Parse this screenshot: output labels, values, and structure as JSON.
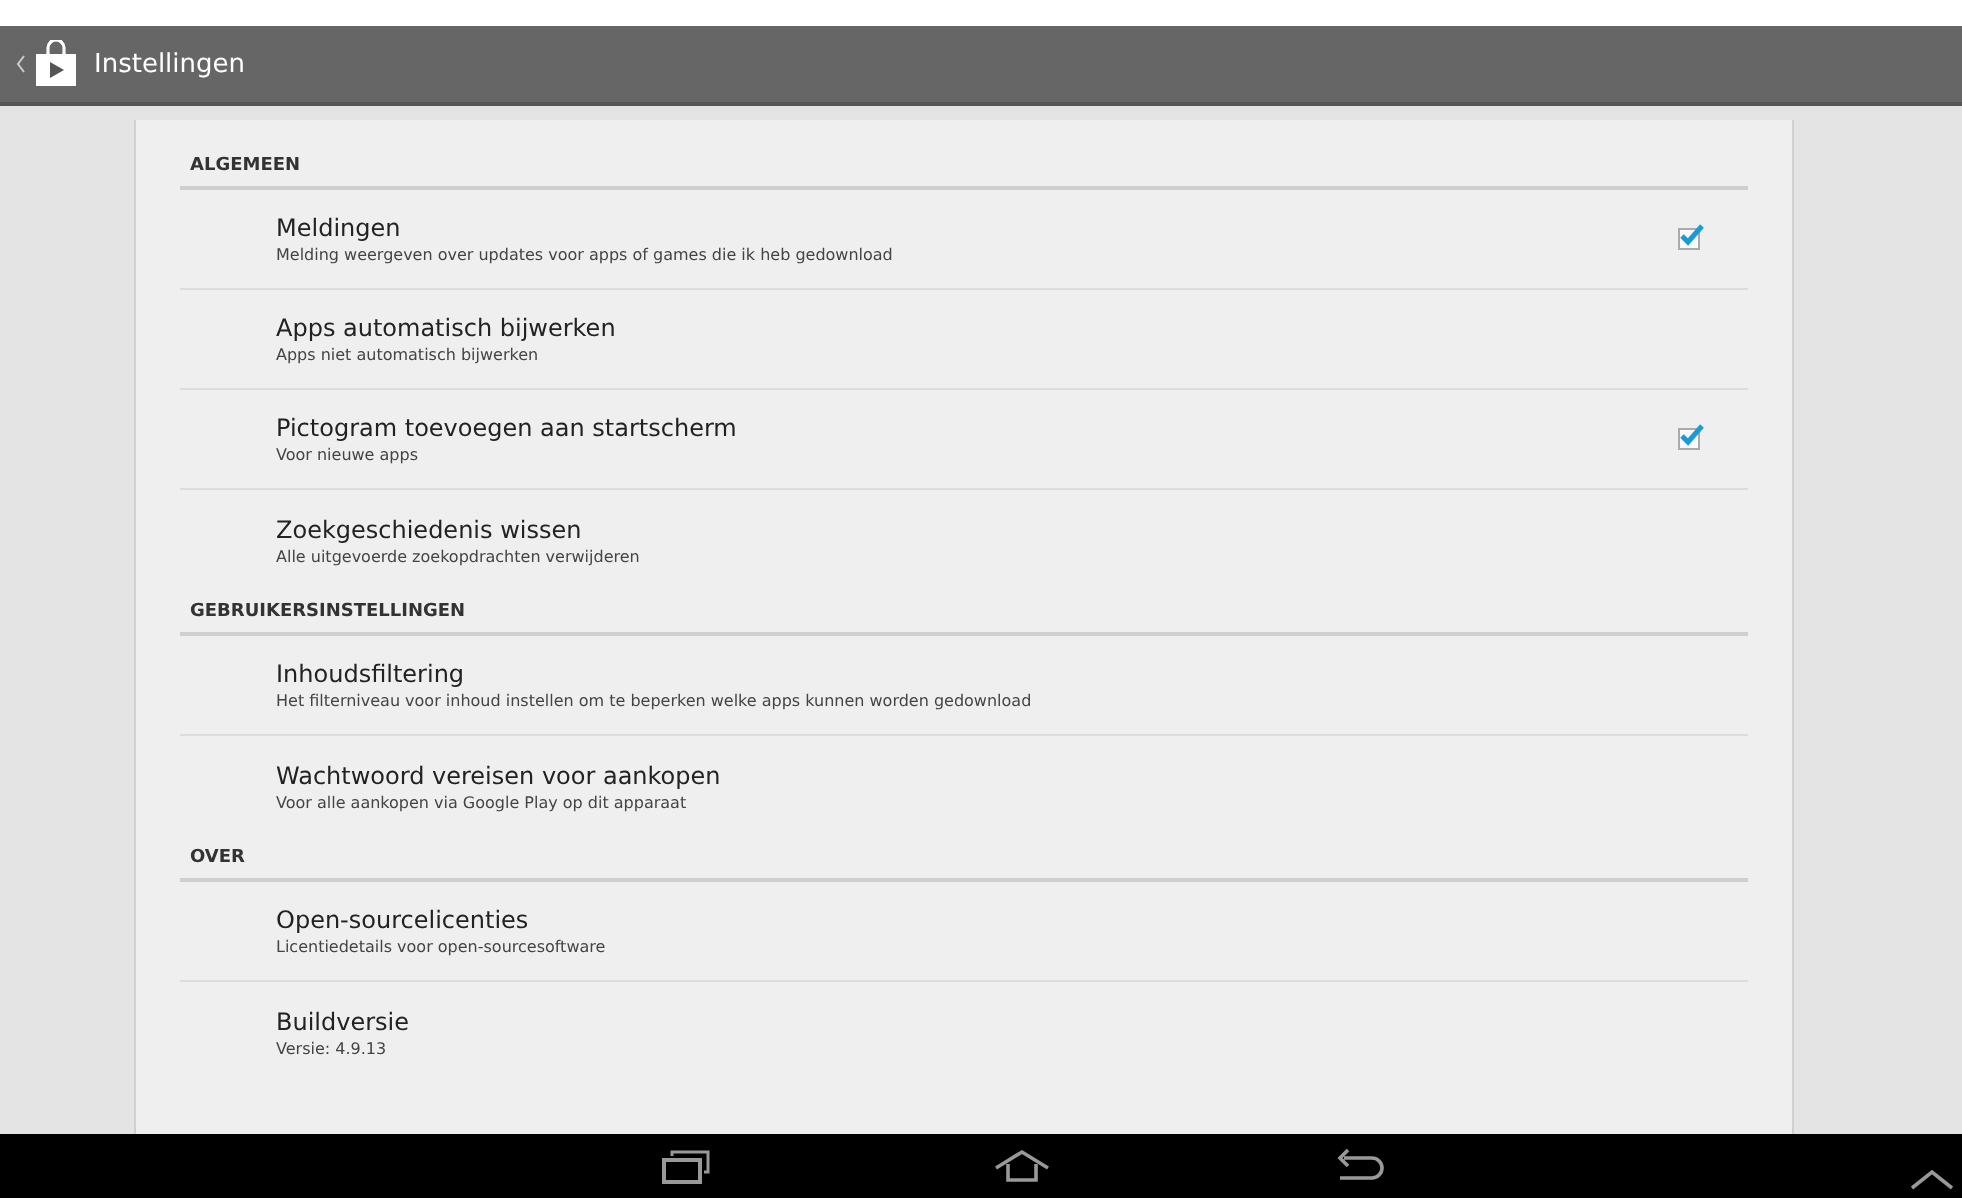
{
  "action_bar": {
    "title": "Instellingen"
  },
  "sections": [
    {
      "heading": "ALGEMEEN",
      "items": [
        {
          "title": "Meldingen",
          "summary": "Melding weergeven over updates voor apps of games die ik heb gedownload",
          "kind": "checkbox",
          "checked": true
        },
        {
          "title": "Apps automatisch bijwerken",
          "summary": "Apps niet automatisch bijwerken",
          "kind": "plain"
        },
        {
          "title": "Pictogram toevoegen aan startscherm",
          "summary": "Voor nieuwe apps",
          "kind": "checkbox",
          "checked": true
        },
        {
          "title": "Zoekgeschiedenis wissen",
          "summary": "Alle uitgevoerde zoekopdrachten verwijderen",
          "kind": "plain"
        }
      ]
    },
    {
      "heading": "GEBRUIKERSINSTELLINGEN",
      "items": [
        {
          "title": "Inhoudsfiltering",
          "summary": "Het filterniveau voor inhoud instellen om te beperken welke apps kunnen worden gedownload",
          "kind": "plain"
        },
        {
          "title": "Wachtwoord vereisen voor aankopen",
          "summary": "Voor alle aankopen via Google Play op dit apparaat",
          "kind": "plain"
        }
      ]
    },
    {
      "heading": "OVER",
      "items": [
        {
          "title": "Open-sourcelicenties",
          "summary": "Licentiedetails voor open-sourcesoftware",
          "kind": "plain"
        },
        {
          "title": "Buildversie",
          "summary": "Versie: 4.9.13",
          "kind": "plain"
        }
      ]
    }
  ]
}
